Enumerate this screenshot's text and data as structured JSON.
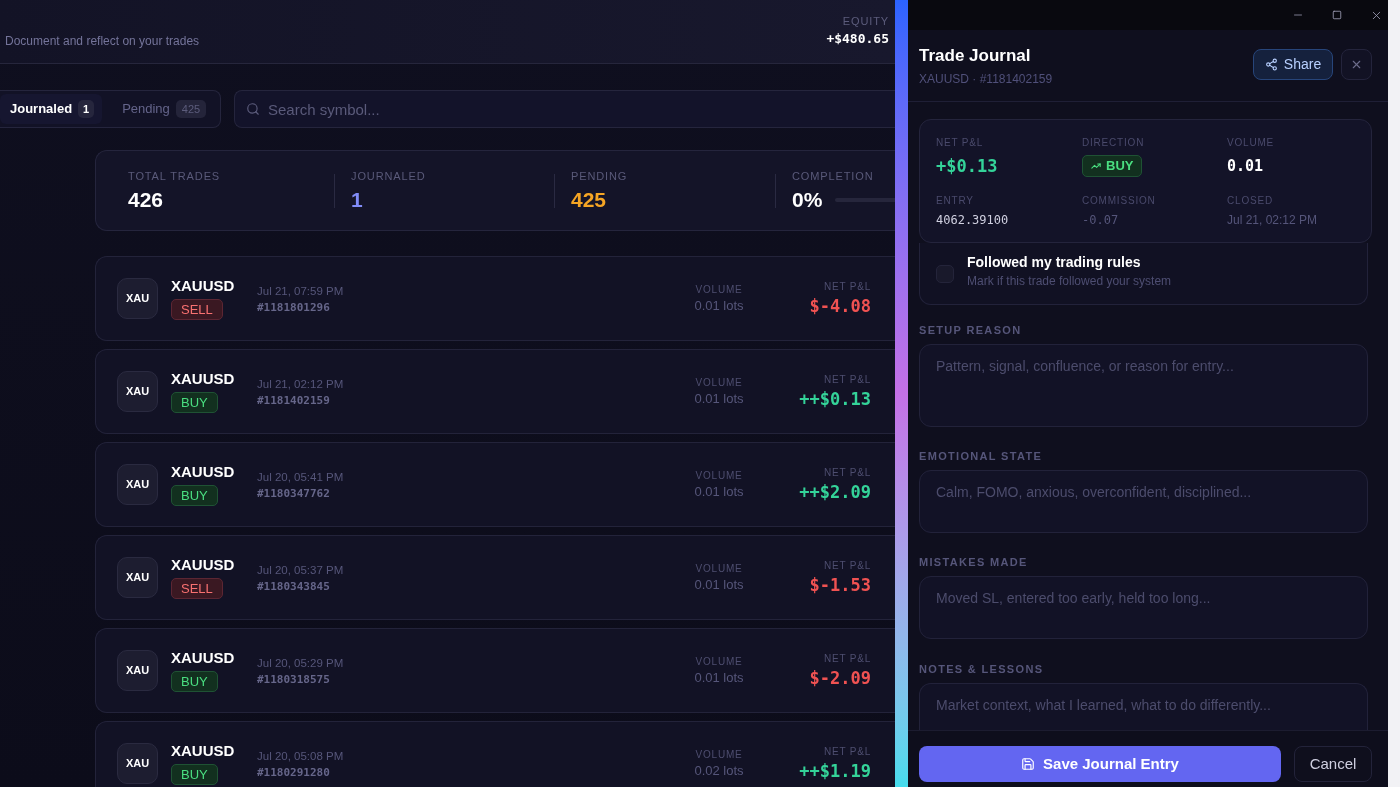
{
  "header": {
    "subtitle": "Document and reflect on your trades",
    "equity_label": "EQUITY",
    "equity_value": "+$480.65"
  },
  "tabs": [
    {
      "label": "Journaled",
      "count": "1",
      "selected": true
    },
    {
      "label": "Pending",
      "count": "425",
      "selected": false
    }
  ],
  "search": {
    "placeholder": "Search symbol..."
  },
  "stats": [
    {
      "kind": "total",
      "label": "TOTAL TRADES",
      "value": "426"
    },
    {
      "kind": "journaled",
      "label": "JOURNALED",
      "value": "1"
    },
    {
      "kind": "pending",
      "label": "PENDING",
      "value": "425"
    },
    {
      "kind": "completion",
      "label": "COMPLETION",
      "value": "0%",
      "level": 0
    }
  ],
  "trades": [
    {
      "symbol_short": "XAU",
      "symbol": "XAUUSD",
      "direction": {
        "label": "SELL",
        "kind": "sell"
      },
      "time": "Jul 21, 07:59 PM",
      "ticket": "#1181801296",
      "volume_label": "VOLUME",
      "volume": "0.01 lots",
      "pnl_label": "NET P&L",
      "pnl": {
        "value": "$-4.08",
        "kind": "loss"
      }
    },
    {
      "symbol_short": "XAU",
      "symbol": "XAUUSD",
      "direction": {
        "label": "BUY",
        "kind": "buy"
      },
      "time": "Jul 21, 02:12 PM",
      "ticket": "#1181402159",
      "volume_label": "VOLUME",
      "volume": "0.01 lots",
      "pnl_label": "NET P&L",
      "pnl": {
        "value": "++$0.13",
        "kind": "profit"
      }
    },
    {
      "symbol_short": "XAU",
      "symbol": "XAUUSD",
      "direction": {
        "label": "BUY",
        "kind": "buy"
      },
      "time": "Jul 20, 05:41 PM",
      "ticket": "#1180347762",
      "volume_label": "VOLUME",
      "volume": "0.01 lots",
      "pnl_label": "NET P&L",
      "pnl": {
        "value": "++$2.09",
        "kind": "profit"
      }
    },
    {
      "symbol_short": "XAU",
      "symbol": "XAUUSD",
      "direction": {
        "label": "SELL",
        "kind": "sell"
      },
      "time": "Jul 20, 05:37 PM",
      "ticket": "#1180343845",
      "volume_label": "VOLUME",
      "volume": "0.01 lots",
      "pnl_label": "NET P&L",
      "pnl": {
        "value": "$-1.53",
        "kind": "loss"
      }
    },
    {
      "symbol_short": "XAU",
      "symbol": "XAUUSD",
      "direction": {
        "label": "BUY",
        "kind": "buy"
      },
      "time": "Jul 20, 05:29 PM",
      "ticket": "#1180318575",
      "volume_label": "VOLUME",
      "volume": "0.01 lots",
      "pnl_label": "NET P&L",
      "pnl": {
        "value": "$-2.09",
        "kind": "loss"
      }
    },
    {
      "symbol_short": "XAU",
      "symbol": "XAUUSD",
      "direction": {
        "label": "BUY",
        "kind": "buy"
      },
      "time": "Jul 20, 05:08 PM",
      "ticket": "#1180291280",
      "volume_label": "VOLUME",
      "volume": "0.02 lots",
      "pnl_label": "NET P&L",
      "pnl": {
        "value": "++$1.19",
        "kind": "profit"
      }
    }
  ],
  "journal": {
    "title": "Trade Journal",
    "subtitle": "XAUUSD · #1181402159",
    "share": "Share",
    "summary": [
      {
        "kind": "profit",
        "label": "NET P&L",
        "value": "+$0.13"
      },
      {
        "kind": "buy",
        "label": "DIRECTION",
        "value": "BUY"
      },
      {
        "kind": "value",
        "label": "VOLUME",
        "value": "0.01"
      },
      {
        "kind": "code",
        "label": "ENTRY",
        "value": "4062.39100"
      },
      {
        "kind": "muted_code",
        "label": "COMMISSION",
        "value": "-0.07"
      },
      {
        "kind": "date",
        "label": "CLOSED",
        "value": "Jul 21, 02:12 PM"
      }
    ],
    "rules": {
      "title": "Followed my trading rules",
      "hint": "Mark if this trade followed your system",
      "checked": false
    },
    "fields": [
      {
        "label": "SETUP REASON",
        "placeholder": "Pattern, signal, confluence, or reason for entry..."
      },
      {
        "label": "EMOTIONAL STATE",
        "placeholder": "Calm, FOMO, anxious, overconfident, disciplined..."
      },
      {
        "label": "MISTAKES MADE",
        "placeholder": "Moved SL, entered too early, held too long..."
      },
      {
        "label": "NOTES & LESSONS",
        "placeholder": "Market context, what I learned, what to do differently..."
      }
    ],
    "save": "Save Journal Entry",
    "cancel": "Cancel"
  }
}
